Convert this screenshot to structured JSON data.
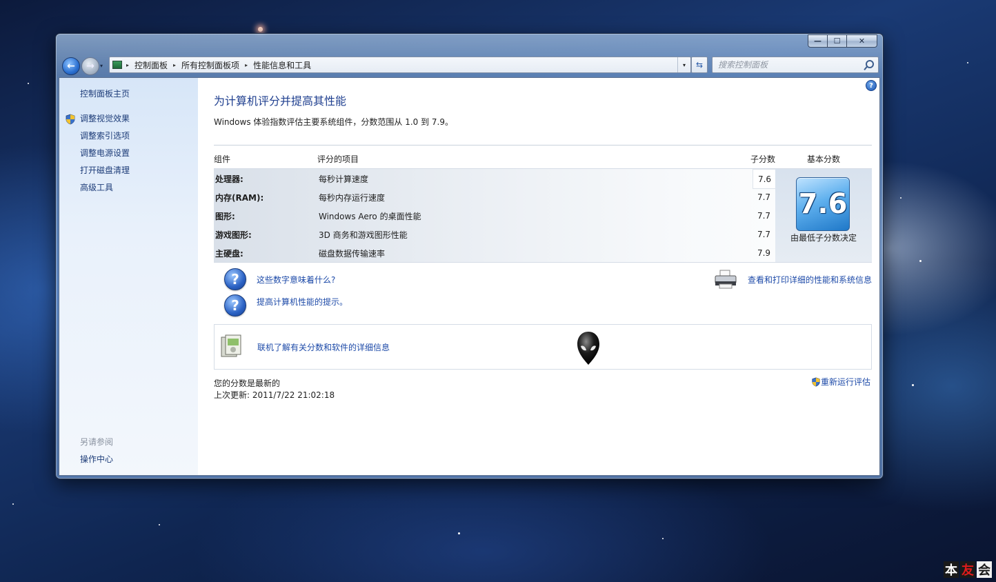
{
  "window": {
    "caption_buttons": {
      "minimize": "—",
      "maximize": "☐",
      "close": "✕"
    }
  },
  "nav": {
    "back": "←",
    "forward": "→",
    "history": "▾"
  },
  "address_bar": {
    "crumbs": [
      "控制面板",
      "所有控制面板项",
      "性能信息和工具"
    ],
    "separator": "▸",
    "dropdown": "▾",
    "refresh": "⇆"
  },
  "search": {
    "placeholder": "搜索控制面板"
  },
  "sidebar": {
    "home": "控制面板主页",
    "tasks": [
      "调整视觉效果",
      "调整索引选项",
      "调整电源设置",
      "打开磁盘清理",
      "高级工具"
    ],
    "see_also_header": "另请参阅",
    "see_also": [
      "操作中心"
    ]
  },
  "main": {
    "help": "?",
    "title": "为计算机评分并提高其性能",
    "description": "Windows 体验指数评估主要系统组件，分数范围从 1.0 到 7.9。",
    "table": {
      "headers": {
        "component": "组件",
        "item": "评分的项目",
        "subscore": "子分数",
        "base": "基本分数"
      },
      "rows": [
        {
          "component": "处理器:",
          "item": "每秒计算速度",
          "subscore": "7.6"
        },
        {
          "component": "内存(RAM):",
          "item": "每秒内存运行速度",
          "subscore": "7.7"
        },
        {
          "component": "图形:",
          "item": "Windows Aero 的桌面性能",
          "subscore": "7.7"
        },
        {
          "component": "游戏图形:",
          "item": "3D 商务和游戏图形性能",
          "subscore": "7.7"
        },
        {
          "component": "主硬盘:",
          "item": "磁盘数据传输速率",
          "subscore": "7.9"
        }
      ],
      "base_score": "7.6",
      "base_caption": "由最低子分数决定"
    },
    "links": {
      "what_mean": "这些数字意味着什么?",
      "tips": "提高计算机性能的提示。",
      "view_print": "查看和打印详细的性能和系统信息",
      "online": "联机了解有关分数和软件的详细信息"
    },
    "status": {
      "current": "您的分数是最新的",
      "last_update": "上次更新: 2011/7/22 21:02:18",
      "rerun": "重新运行评估"
    }
  },
  "watermark": [
    "本",
    "友",
    "会"
  ],
  "colors": {
    "link": "#1d4aa8",
    "title": "#1f3f8f",
    "sidebar_link": "#1d3c78"
  }
}
